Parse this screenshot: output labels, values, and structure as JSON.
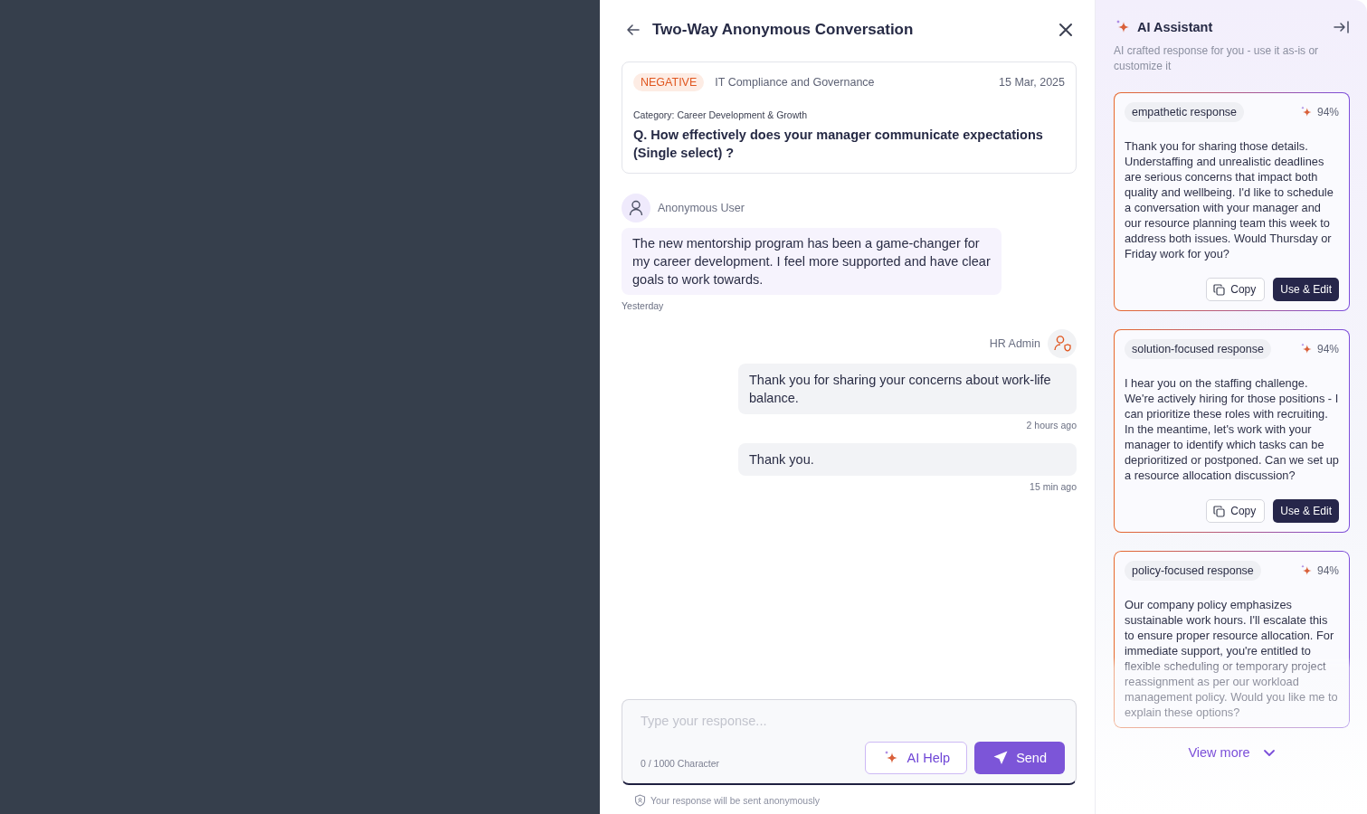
{
  "conversation": {
    "title": "Two-Way Anonymous Conversation",
    "question_card": {
      "sentiment": "NEGATIVE",
      "department": "IT Compliance and Governance",
      "date": "15 Mar, 2025",
      "category": "Category: Career Development & Growth",
      "question": "Q. How effectively does your manager communicate expectations (Single select) ?"
    },
    "messages": [
      {
        "kind": "incoming",
        "author": "Anonymous User",
        "text": "The new mentorship program has been a game-changer for my career development. I feel more supported and have clear goals to work towards.",
        "time": "Yesterday"
      },
      {
        "kind": "outgoing",
        "author": "HR Admin",
        "text": "Thank you for sharing your concerns about work-life balance.",
        "time": "2 hours ago"
      },
      {
        "kind": "outgoing",
        "text": "Thank you.",
        "time": "15 min ago"
      }
    ],
    "composer": {
      "placeholder": "Type your response...",
      "counter": "0 / 1000 Character",
      "buttons": [
        {
          "kind": "ai",
          "label": "AI Help"
        },
        {
          "kind": "send",
          "label": "Send"
        }
      ]
    },
    "footnote": "Your response will be sent anonymously"
  },
  "assistant": {
    "title": "AI Assistant",
    "subtitle": "AI crafted response for you - use it as-is or customize it",
    "suggestions": [
      {
        "tag": "empathetic response",
        "score": "94%",
        "faded": false,
        "text": "Thank you for sharing those details. Understaffing and unrealistic deadlines are serious concerns that impact both quality and wellbeing. I'd like to schedule a conversation with your manager and our resource planning team this week to address both issues. Would Thursday or Friday work for you?",
        "buttons": [
          {
            "kind": "copy",
            "label": "Copy"
          },
          {
            "kind": "use",
            "label": "Use & Edit"
          }
        ]
      },
      {
        "tag": "solution-focused response",
        "score": "94%",
        "faded": false,
        "text": "I hear you on the staffing challenge. We're actively hiring for those positions - I can prioritize these roles with recruiting. In the meantime, let's work with your manager to identify which tasks can be deprioritized or postponed. Can we set up a resource allocation discussion?",
        "buttons": [
          {
            "kind": "copy",
            "label": "Copy"
          },
          {
            "kind": "use",
            "label": "Use & Edit"
          }
        ]
      },
      {
        "tag": "policy-focused response",
        "score": "94%",
        "faded": true,
        "text": "Our company policy emphasizes sustainable work hours. I'll escalate this to ensure proper resource allocation. For immediate support, you're entitled to flexible scheduling or temporary project reassignment as per our workload management policy. Would you like me to explain these options?"
      }
    ],
    "view_more": "View more"
  }
}
